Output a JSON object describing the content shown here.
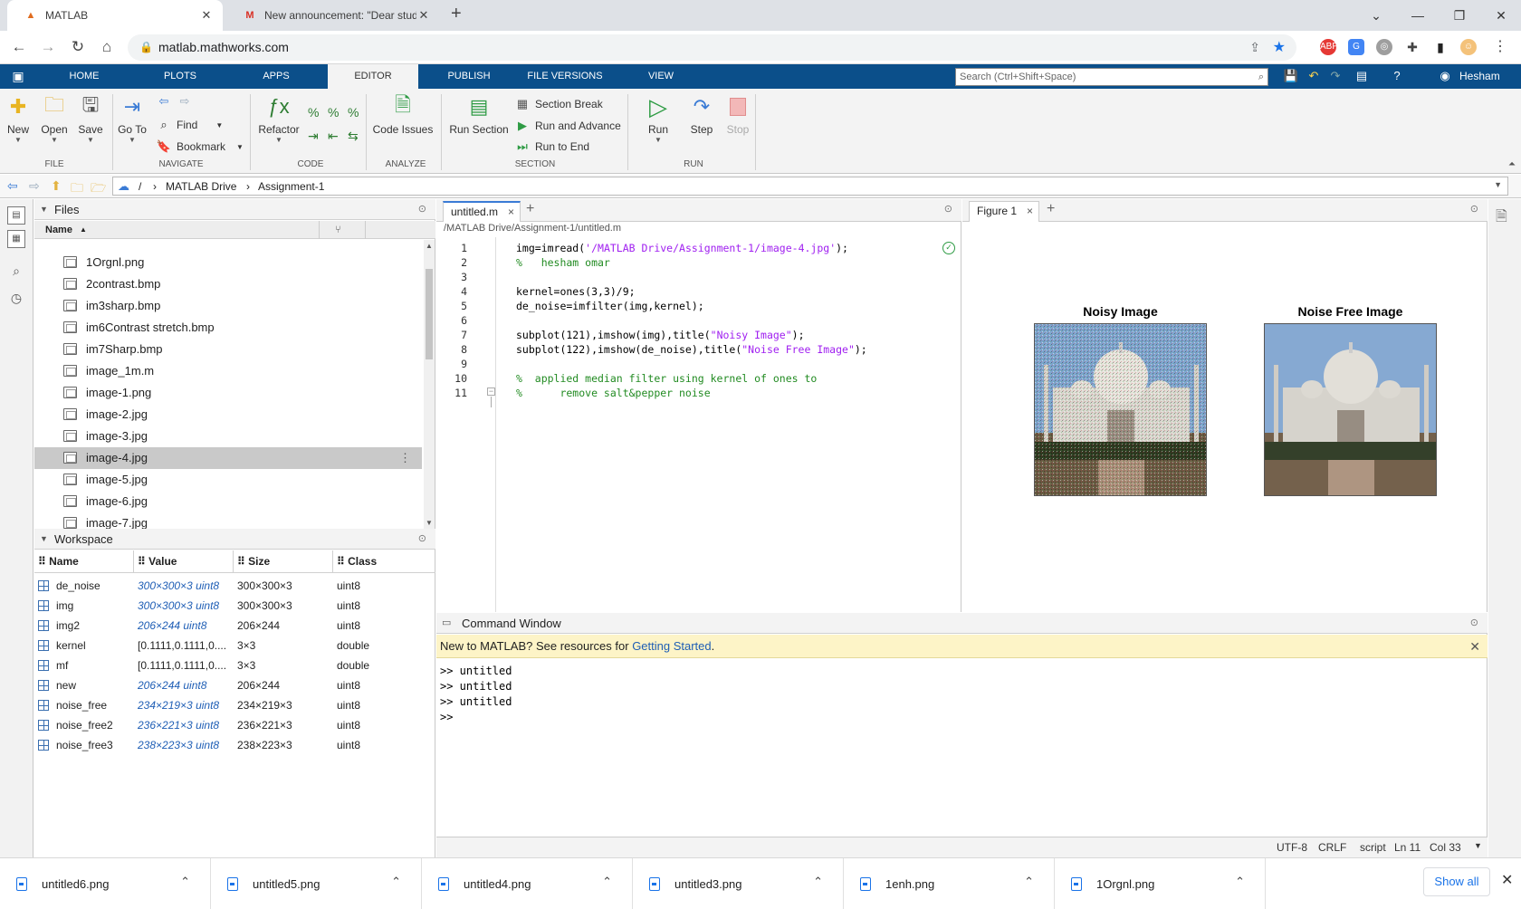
{
  "browser": {
    "tabs": [
      {
        "title": "MATLAB",
        "active": true
      },
      {
        "title": "New announcement: \"Dear stude",
        "active": false
      }
    ],
    "url": "matlab.mathworks.com"
  },
  "toolstrip": {
    "tabs": [
      "HOME",
      "PLOTS",
      "APPS",
      "EDITOR",
      "PUBLISH",
      "FILE VERSIONS",
      "VIEW"
    ],
    "active_tab": "EDITOR",
    "search_placeholder": "Search (Ctrl+Shift+Space)",
    "user": "Hesham"
  },
  "ribbon": {
    "file": {
      "new": "New",
      "open": "Open",
      "save": "Save",
      "group": "FILE"
    },
    "navigate": {
      "goto": "Go To",
      "find": "Find",
      "bookmark": "Bookmark",
      "group": "NAVIGATE"
    },
    "code": {
      "refactor": "Refactor",
      "group": "CODE"
    },
    "analyze": {
      "code_issues": "Code Issues",
      "group": "ANALYZE"
    },
    "section": {
      "run_section": "Run Section",
      "section_break": "Section Break",
      "run_and_advance": "Run and Advance",
      "run_to_end": "Run to End",
      "group": "SECTION"
    },
    "run": {
      "run": "Run",
      "step": "Step",
      "stop": "Stop",
      "group": "RUN"
    }
  },
  "path": {
    "root": "/",
    "crumbs": [
      "MATLAB Drive",
      "Assignment-1"
    ]
  },
  "files": {
    "title": "Files",
    "column": "Name",
    "items": [
      "1Orgnl.png",
      "2contrast.bmp",
      "im3sharp.bmp",
      "im6Contrast stretch.bmp",
      "im7Sharp.bmp",
      "image_1m.m",
      "image-1.png",
      "image-2.jpg",
      "image-3.jpg",
      "image-4.jpg",
      "image-5.jpg",
      "image-6.jpg",
      "image-7.jpg"
    ],
    "selected": "image-4.jpg"
  },
  "workspace": {
    "title": "Workspace",
    "columns": [
      "Name",
      "Value",
      "Size",
      "Class"
    ],
    "rows": [
      {
        "name": "de_noise",
        "value": "300×300×3 uint8",
        "size": "300×300×3",
        "class": "uint8",
        "italic": true
      },
      {
        "name": "img",
        "value": "300×300×3 uint8",
        "size": "300×300×3",
        "class": "uint8",
        "italic": true
      },
      {
        "name": "img2",
        "value": "206×244 uint8",
        "size": "206×244",
        "class": "uint8",
        "italic": true
      },
      {
        "name": "kernel",
        "value": "[0.1111,0.1111,0....",
        "size": "3×3",
        "class": "double",
        "italic": false
      },
      {
        "name": "mf",
        "value": "[0.1111,0.1111,0....",
        "size": "3×3",
        "class": "double",
        "italic": false
      },
      {
        "name": "new",
        "value": "206×244 uint8",
        "size": "206×244",
        "class": "uint8",
        "italic": true
      },
      {
        "name": "noise_free",
        "value": "234×219×3 uint8",
        "size": "234×219×3",
        "class": "uint8",
        "italic": true
      },
      {
        "name": "noise_free2",
        "value": "236×221×3 uint8",
        "size": "236×221×3",
        "class": "uint8",
        "italic": true
      },
      {
        "name": "noise_free3",
        "value": "238×223×3 uint8",
        "size": "238×223×3",
        "class": "uint8",
        "italic": true
      }
    ]
  },
  "editor": {
    "tab": "untitled.m",
    "path": "/MATLAB Drive/Assignment-1/untitled.m",
    "lines": [
      [
        {
          "t": "img=imread(",
          "c": ""
        },
        {
          "t": "'/MATLAB Drive/Assignment-1/image-4.jpg'",
          "c": "str"
        },
        {
          "t": ");",
          "c": ""
        }
      ],
      [
        {
          "t": "%   hesham omar",
          "c": "cmt"
        }
      ],
      [],
      [
        {
          "t": "kernel=ones(3,3)/9;",
          "c": ""
        }
      ],
      [
        {
          "t": "de_noise=imfilter(img,kernel);",
          "c": ""
        }
      ],
      [],
      [
        {
          "t": "subplot(121),imshow(img),title(",
          "c": ""
        },
        {
          "t": "\"Noisy Image\"",
          "c": "str"
        },
        {
          "t": ");",
          "c": ""
        }
      ],
      [
        {
          "t": "subplot(122),imshow(de_noise),title(",
          "c": ""
        },
        {
          "t": "\"Noise Free Image\"",
          "c": "str"
        },
        {
          "t": ");",
          "c": ""
        }
      ],
      [],
      [
        {
          "t": "%  applied median filter using kernel of ones to",
          "c": "cmt"
        }
      ],
      [
        {
          "t": "%      remove salt&pepper noise",
          "c": "cmt"
        }
      ]
    ]
  },
  "figure": {
    "tab": "Figure 1",
    "titles": [
      "Noisy Image",
      "Noise Free Image"
    ]
  },
  "command_window": {
    "title": "Command Window",
    "notice_text": "New to MATLAB? See resources for ",
    "notice_link": "Getting Started",
    "notice_end": ".",
    "lines": [
      ">> untitled",
      ">> untitled",
      ">> untitled",
      ">>"
    ]
  },
  "status": {
    "encoding": "UTF-8",
    "eol": "CRLF",
    "type": "script",
    "ln": "Ln  11",
    "col": "Col  33"
  },
  "downloads": {
    "items": [
      "untitled6.png",
      "untitled5.png",
      "untitled4.png",
      "untitled3.png",
      "1enh.png",
      "1Orgnl.png"
    ],
    "show_all": "Show all"
  }
}
